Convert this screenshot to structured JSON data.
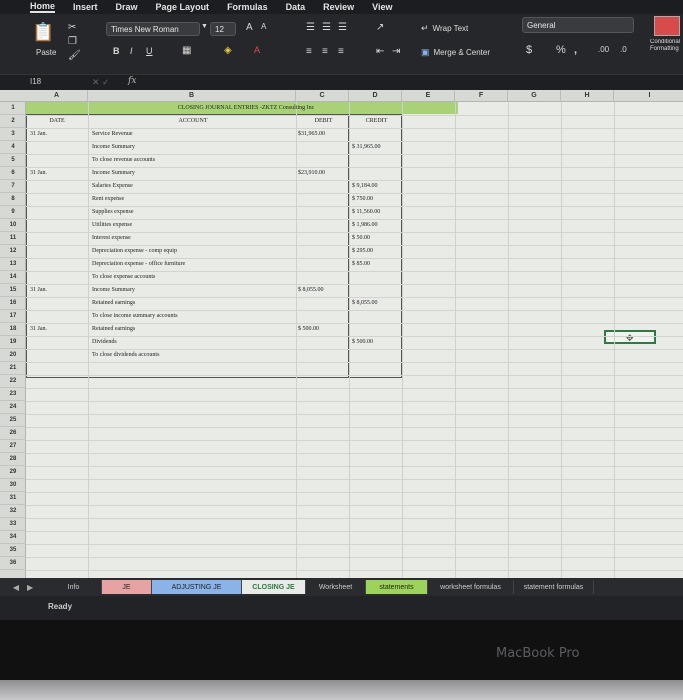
{
  "ribbon_tabs": [
    "Home",
    "Insert",
    "Draw",
    "Page Layout",
    "Formulas",
    "Data",
    "Review",
    "View"
  ],
  "ribbon": {
    "paste_label": "Paste",
    "font_name": "Times New Roman",
    "font_size": "12",
    "wrap_text": "Wrap Text",
    "merge_center": "Merge & Center",
    "number_format": "General",
    "currency_symbol": "$",
    "percent_symbol": "%",
    "comma_symbol": ",",
    "conditional_format": "Conditional Formatting"
  },
  "formula_bar": {
    "name_box": "I18",
    "fx": "fx"
  },
  "columns": [
    "A",
    "B",
    "C",
    "D",
    "E",
    "F",
    "G",
    "H",
    "I"
  ],
  "rows": [
    "1",
    "2",
    "3",
    "4",
    "5",
    "6",
    "7",
    "8",
    "9",
    "10",
    "11",
    "12",
    "13",
    "14",
    "15",
    "16",
    "17",
    "18",
    "19",
    "20",
    "21",
    "22",
    "23",
    "24",
    "25",
    "26",
    "27",
    "28",
    "29",
    "30",
    "31",
    "32",
    "33",
    "34",
    "35",
    "36"
  ],
  "sheet": {
    "title": "CLOSING JOURNAL ENTRIES -ZKTZ Consulting Inc",
    "headers": {
      "date": "DATE",
      "account": "ACCOUNT",
      "debit": "DEBIT",
      "credit": "CREDIT"
    },
    "entries": [
      {
        "row": 3,
        "date": "31 Jan.",
        "account": "Service Revenue",
        "debit": "$31,965.00",
        "credit": ""
      },
      {
        "row": 4,
        "date": "",
        "account": "Income Summary",
        "debit": "",
        "credit": "$   31,965.00"
      },
      {
        "row": 5,
        "date": "",
        "account": "To close revenue accounts",
        "debit": "",
        "credit": ""
      },
      {
        "row": 6,
        "date": "31 Jan.",
        "account": "Income Summary",
        "debit": "$23,910.00",
        "credit": ""
      },
      {
        "row": 7,
        "date": "",
        "account": "Salaries Expense",
        "debit": "",
        "credit": "$     9,184.00"
      },
      {
        "row": 8,
        "date": "",
        "account": "Rent expense",
        "debit": "",
        "credit": "$       750.00"
      },
      {
        "row": 9,
        "date": "",
        "account": "Supplies expense",
        "debit": "",
        "credit": "$   11,560.00"
      },
      {
        "row": 10,
        "date": "",
        "account": "Utilities expense",
        "debit": "",
        "credit": "$     1,986.00"
      },
      {
        "row": 11,
        "date": "",
        "account": "Interest expense",
        "debit": "",
        "credit": "$         50.00"
      },
      {
        "row": 12,
        "date": "",
        "account": "Depreciation expense - comp equip",
        "debit": "",
        "credit": "$       295.00"
      },
      {
        "row": 13,
        "date": "",
        "account": "Depreciation expense - office furniture",
        "debit": "",
        "credit": "$         85.00"
      },
      {
        "row": 14,
        "date": "",
        "account": "To close expense accounts",
        "debit": "",
        "credit": ""
      },
      {
        "row": 15,
        "date": "31 Jan.",
        "account": "Income Summary",
        "debit": "$   8,055.00",
        "credit": ""
      },
      {
        "row": 16,
        "date": "",
        "account": "Retained earnings",
        "debit": "",
        "credit": "$     8,055.00"
      },
      {
        "row": 17,
        "date": "",
        "account": "To close income summary accounts",
        "debit": "",
        "credit": ""
      },
      {
        "row": 18,
        "date": "31 Jan.",
        "account": "Retained earnings",
        "debit": "$      500.00",
        "credit": ""
      },
      {
        "row": 19,
        "date": "",
        "account": "Dividends",
        "debit": "",
        "credit": "$       500.00"
      },
      {
        "row": 20,
        "date": "",
        "account": "To close dividends accounts",
        "debit": "",
        "credit": ""
      }
    ]
  },
  "sheet_tabs": [
    {
      "label": "Info",
      "color": "#2a2b2e"
    },
    {
      "label": "JE",
      "color": "#e7a3a3"
    },
    {
      "label": "ADJUSTING JE",
      "color": "#8ab4e8"
    },
    {
      "label": "CLOSING JE",
      "color": "#e9ebe7"
    },
    {
      "label": "Worksheet",
      "color": "#2a2b2e"
    },
    {
      "label": "statements",
      "color": "#9ed35b"
    },
    {
      "label": "worksheet formulas",
      "color": "#2a2b2e"
    },
    {
      "label": "statement formulas",
      "color": "#2a2b2e"
    }
  ],
  "status": "Ready",
  "brand": "MacBook Pro"
}
